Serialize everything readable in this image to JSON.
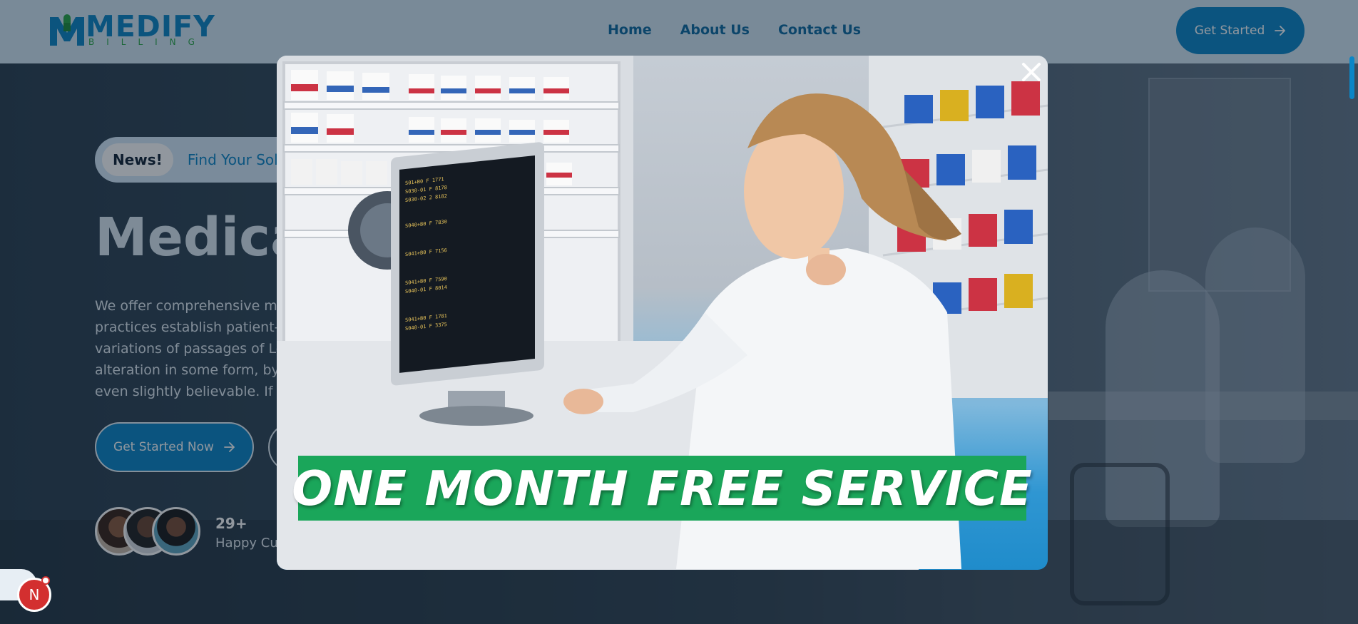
{
  "header": {
    "logo_text": "MEDIFY",
    "logo_subtext": "BILLING",
    "nav": [
      "Home",
      "About Us",
      "Contact Us"
    ],
    "cta_label": "Get Started",
    "cta_icon": "arrow-right-icon"
  },
  "hero": {
    "news_tag": "News!",
    "news_text": "Find Your Solu",
    "title": "Medica",
    "description": [
      "We offer comprehensive med",
      "practices establish patient-ce",
      "variations of passages of Lore",
      "alteration in some form, by inj",
      "even slightly believable. If you"
    ],
    "cta_primary_label": "Get Started Now",
    "stat_number": "29+",
    "stat_label": "Happy Cust"
  },
  "modal": {
    "promo_text": "ONE MONTH FREE SERVICE",
    "close_icon": "close-icon"
  },
  "widget": {
    "label": "N"
  },
  "colors": {
    "brand_blue": "#0b86c7",
    "brand_green": "#1aa65a",
    "header_bg": "#d3e8f5"
  }
}
